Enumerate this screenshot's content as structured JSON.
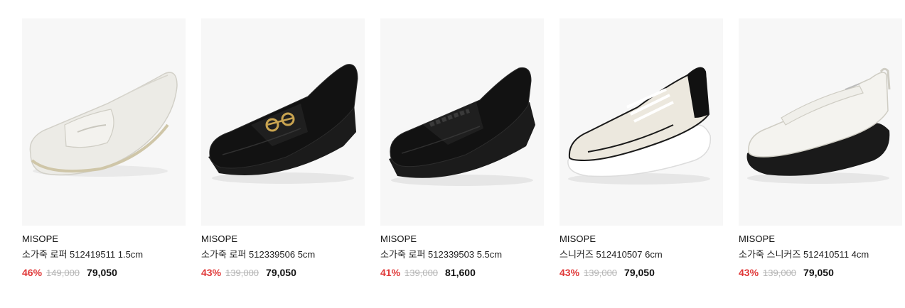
{
  "products": [
    {
      "image_icon": "white-penny-loafer-image",
      "brand": "MISOPE",
      "name": "소가죽 로퍼 512419511 1.5cm",
      "discount": "46%",
      "original_price": "149,000",
      "sale_price": "79,050"
    },
    {
      "image_icon": "black-horsebit-loafer-image",
      "brand": "MISOPE",
      "name": "소가죽 로퍼 512339506 5cm",
      "discount": "43%",
      "original_price": "139,000",
      "sale_price": "79,050"
    },
    {
      "image_icon": "black-chain-loafer-image",
      "brand": "MISOPE",
      "name": "소가죽 로퍼 512339503 5.5cm",
      "discount": "41%",
      "original_price": "139,000",
      "sale_price": "81,600"
    },
    {
      "image_icon": "white-chunky-sneaker-image",
      "brand": "MISOPE",
      "name": "스니커즈 512410507 6cm",
      "discount": "43%",
      "original_price": "139,000",
      "sale_price": "79,050"
    },
    {
      "image_icon": "white-maryjane-sneaker-image",
      "brand": "MISOPE",
      "name": "소가죽 스니커즈 512410511 4cm",
      "discount": "43%",
      "original_price": "139,000",
      "sale_price": "79,050"
    }
  ],
  "colors": {
    "discount": "#e03a3a",
    "original_price": "#b5b5b5",
    "thumb_bg": "#f7f7f7"
  }
}
